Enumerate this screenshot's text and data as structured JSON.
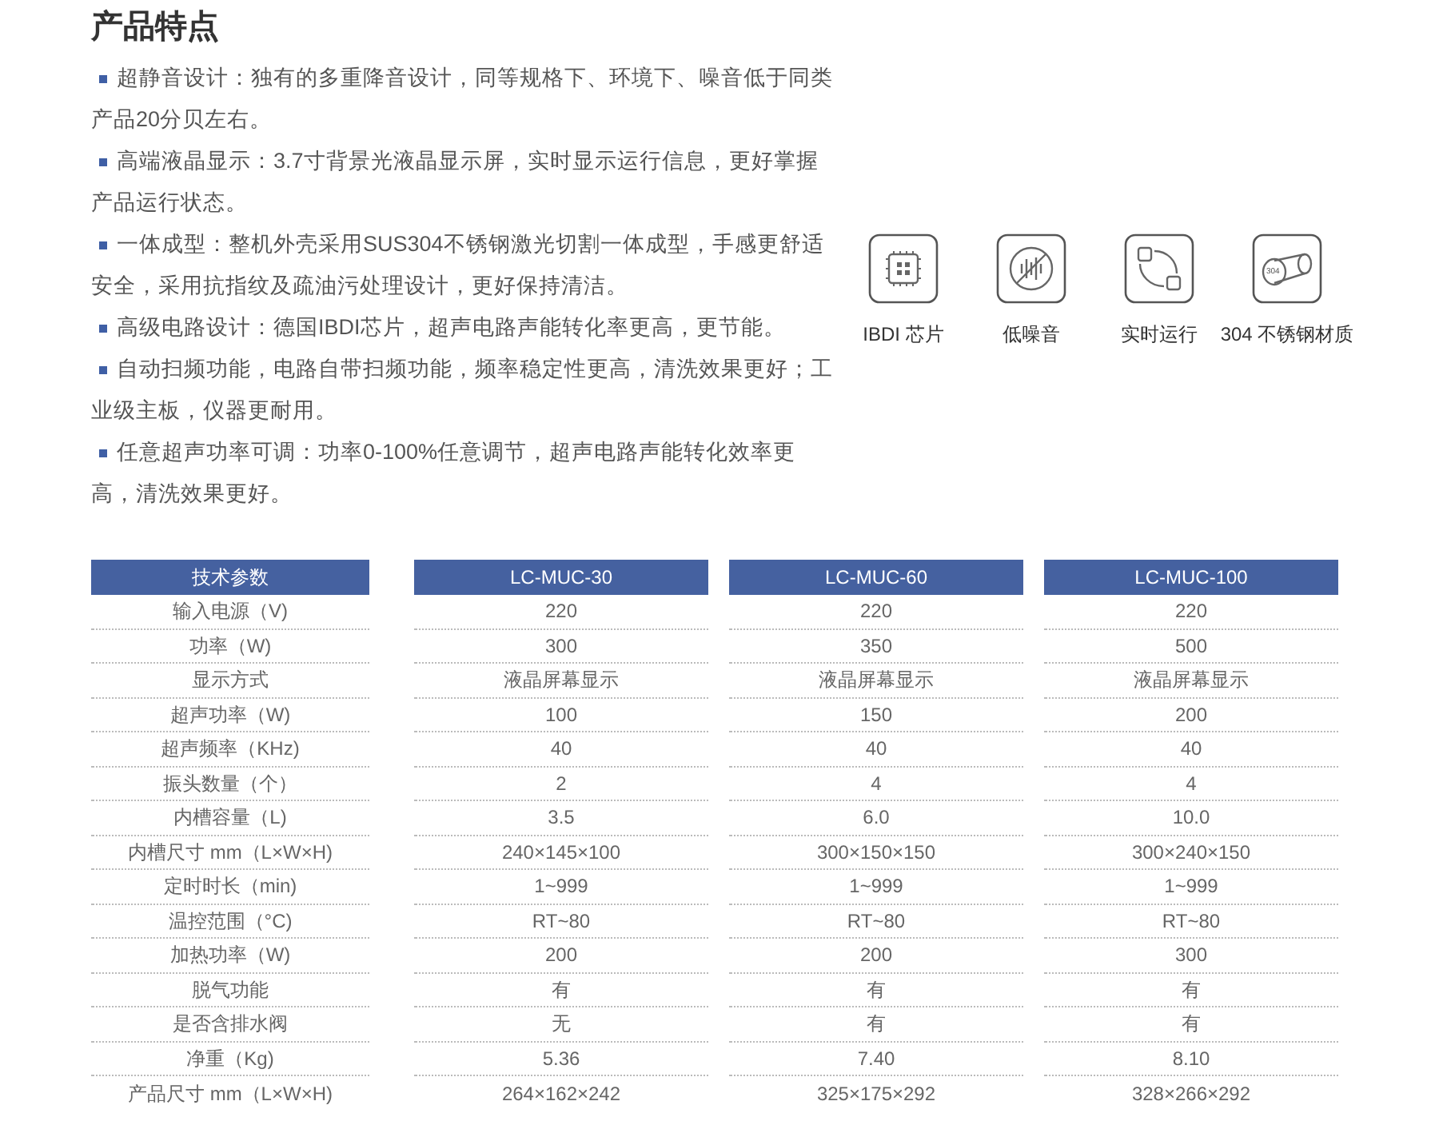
{
  "title": "产品特点",
  "features": [
    "超静音设计：独有的多重降音设计，同等规格下、环境下、噪音低于同类产品20分贝左右。",
    "高端液晶显示：3.7寸背景光液晶显示屏，实时显示运行信息，更好掌握产品运行状态。",
    "一体成型：整机外壳采用SUS304不锈钢激光切割一体成型，手感更舒适安全，采用抗指纹及疏油污处理设计，更好保持清洁。",
    "高级电路设计：德国IBDI芯片，超声电路声能转化率更高，更节能。",
    "自动扫频功能，电路自带扫频功能，频率稳定性更高，清洗效果更好；工业级主板，仪器更耐用。",
    "任意超声功率可调：功率0-100%任意调节，超声电路声能转化效率更高，清洗效果更好。"
  ],
  "badges": [
    {
      "kind": "chip",
      "label": "IBDI 芯片"
    },
    {
      "kind": "quiet",
      "label": "低噪音"
    },
    {
      "kind": "sync",
      "label": "实时运行"
    },
    {
      "kind": "steel",
      "label": "304 不锈钢材质",
      "icon_text": "304"
    }
  ],
  "table": {
    "columns": [
      "技术参数",
      "LC-MUC-30",
      "LC-MUC-60",
      "LC-MUC-100"
    ],
    "rows": [
      [
        "输入电源（V)",
        "220",
        "220",
        "220"
      ],
      [
        "功率（W)",
        "300",
        "350",
        "500"
      ],
      [
        "显示方式",
        "液晶屏幕显示",
        "液晶屏幕显示",
        "液晶屏幕显示"
      ],
      [
        "超声功率（W)",
        "100",
        "150",
        "200"
      ],
      [
        "超声频率（KHz)",
        "40",
        "40",
        "40"
      ],
      [
        "振头数量（个）",
        "2",
        "4",
        "4"
      ],
      [
        "内槽容量（L)",
        "3.5",
        "6.0",
        "10.0"
      ],
      [
        "内槽尺寸 mm（L×W×H)",
        "240×145×100",
        "300×150×150",
        "300×240×150"
      ],
      [
        "定时时长（min)",
        "1~999",
        "1~999",
        "1~999"
      ],
      [
        "温控范围（°C)",
        "RT~80",
        "RT~80",
        "RT~80"
      ],
      [
        "加热功率（W)",
        "200",
        "200",
        "300"
      ],
      [
        "脱气功能",
        "有",
        "有",
        "有"
      ],
      [
        "是否含排水阀",
        "无",
        "有",
        "有"
      ],
      [
        "净重（Kg)",
        "5.36",
        "7.40",
        "8.10"
      ],
      [
        "产品尺寸 mm（L×W×H)",
        "264×162×242",
        "325×175×292",
        "328×266×292"
      ]
    ]
  }
}
